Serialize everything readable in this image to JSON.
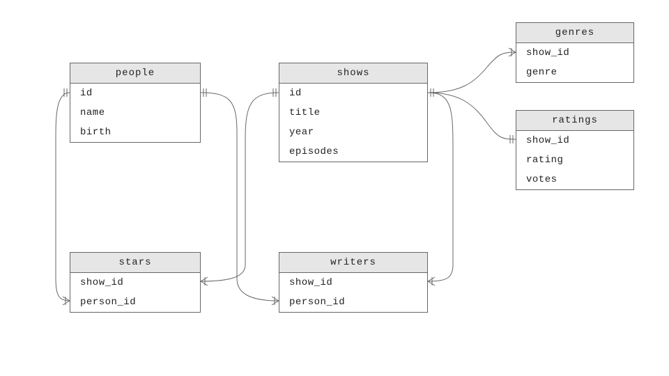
{
  "entities": {
    "people": {
      "name": "people",
      "fields": [
        "id",
        "name",
        "birth"
      ]
    },
    "shows": {
      "name": "shows",
      "fields": [
        "id",
        "title",
        "year",
        "episodes"
      ]
    },
    "genres": {
      "name": "genres",
      "fields": [
        "show_id",
        "genre"
      ]
    },
    "ratings": {
      "name": "ratings",
      "fields": [
        "show_id",
        "rating",
        "votes"
      ]
    },
    "stars": {
      "name": "stars",
      "fields": [
        "show_id",
        "person_id"
      ]
    },
    "writers": {
      "name": "writers",
      "fields": [
        "show_id",
        "person_id"
      ]
    }
  },
  "relationships": [
    {
      "from": "people.id",
      "to": "stars.person_id",
      "cardinality": "one-to-many"
    },
    {
      "from": "people.id",
      "to": "writers.person_id",
      "cardinality": "one-to-many"
    },
    {
      "from": "shows.id",
      "to": "stars.show_id",
      "cardinality": "one-to-many"
    },
    {
      "from": "shows.id",
      "to": "writers.show_id",
      "cardinality": "one-to-many"
    },
    {
      "from": "shows.id",
      "to": "genres.show_id",
      "cardinality": "one-to-many"
    },
    {
      "from": "shows.id",
      "to": "ratings.show_id",
      "cardinality": "one-to-one"
    }
  ]
}
